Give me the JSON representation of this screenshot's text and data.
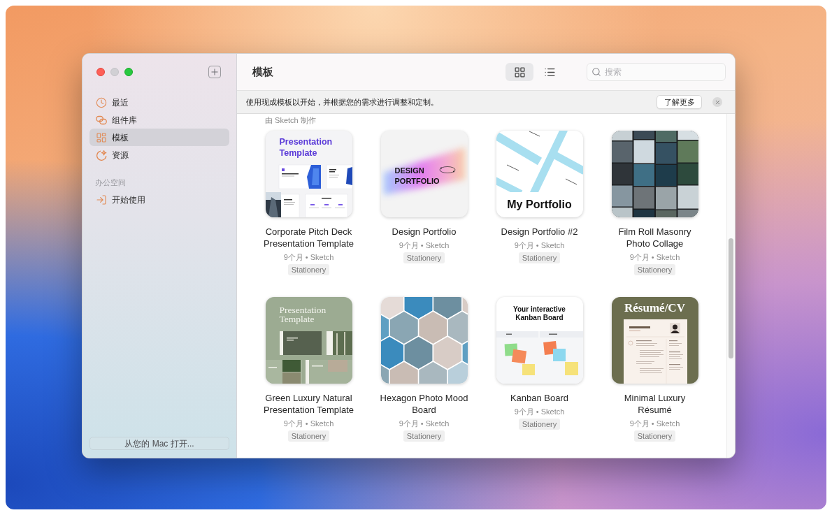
{
  "window": {
    "controls": [
      {
        "kind": "close",
        "disabled": false
      },
      {
        "kind": "minimize",
        "disabled": true
      },
      {
        "kind": "zoom",
        "disabled": false
      }
    ]
  },
  "sidebar": {
    "items": [
      {
        "label": "最近",
        "selected": false
      },
      {
        "label": "组件库",
        "selected": false
      },
      {
        "label": "模板",
        "selected": true
      },
      {
        "label": "资源",
        "selected": false
      }
    ],
    "sections": [
      {
        "title": "办公空间",
        "items": [
          {
            "label": "开始使用",
            "selected": false
          }
        ]
      }
    ],
    "open_button": "从您的 Mac 打开..."
  },
  "toolbar": {
    "title": "模板",
    "views": [
      {
        "kind": "grid",
        "selected": true
      },
      {
        "kind": "list",
        "selected": false
      }
    ],
    "search": {
      "placeholder": "搜索"
    }
  },
  "banner": {
    "text": "使用现成模板以开始，并根据您的需求进行调整和定制。",
    "button": "了解更多"
  },
  "gallery": {
    "section": "由 Sketch 制作",
    "templates": [
      {
        "title": "Corporate Pitch Deck Presentation Template",
        "meta": "9个月 • Sketch",
        "tag": "Stationery",
        "preview": {
          "kind": "pitch-deck",
          "headline": "Presentation Template"
        }
      },
      {
        "title": "Design Portfolio",
        "meta": "9个月 • Sketch",
        "tag": "Stationery",
        "preview": {
          "kind": "gradient",
          "headline": "DESIGN PORTFOLIO"
        }
      },
      {
        "title": "Design Portfolio #2",
        "meta": "9个月 • Sketch",
        "tag": "Stationery",
        "preview": {
          "kind": "stripes",
          "headline": "My Portfolio"
        }
      },
      {
        "title": "Film Roll Masonry Photo Collage",
        "meta": "9个月 • Sketch",
        "tag": "Stationery",
        "preview": {
          "kind": "photo-grid"
        }
      },
      {
        "title": "Green Luxury Natural Presentation Template",
        "meta": "9个月 • Sketch",
        "tag": "Stationery",
        "preview": {
          "kind": "green-deck",
          "headline": "Presentation Template"
        }
      },
      {
        "title": "Hexagon Photo Mood Board",
        "meta": "9个月 • Sketch",
        "tag": "Stationery",
        "preview": {
          "kind": "hexagon"
        }
      },
      {
        "title": "Kanban Board",
        "meta": "9个月 • Sketch",
        "tag": "Stationery",
        "preview": {
          "kind": "kanban",
          "headline": "Your interactive Kanban Board"
        }
      },
      {
        "title": "Minimal Luxury Résumé",
        "meta": "9个月 • Sketch",
        "tag": "Stationery",
        "preview": {
          "kind": "resume",
          "headline": "Résumé/CV"
        }
      }
    ]
  }
}
